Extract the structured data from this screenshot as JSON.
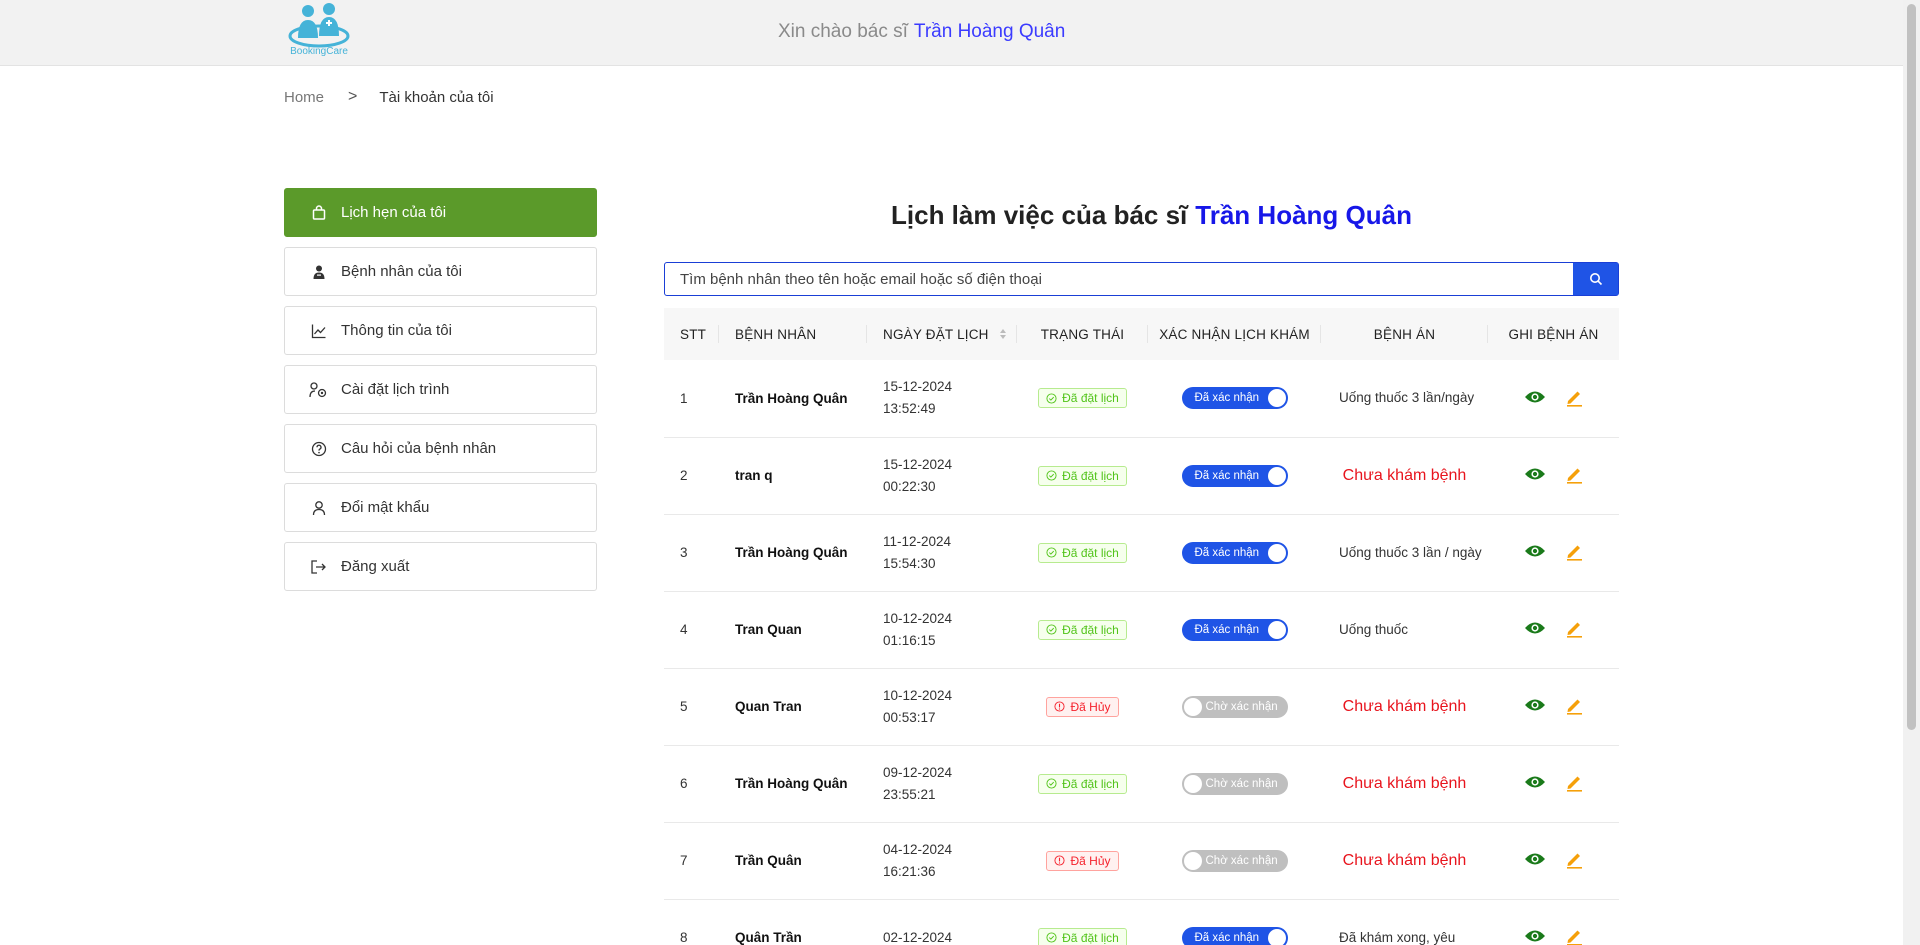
{
  "header": {
    "logo_text": "BookingCare",
    "greeting": "Xin chào bác sĩ",
    "doctor_name": "Trần Hoàng Quân"
  },
  "breadcrumb": {
    "home": "Home",
    "separator": ">",
    "current": "Tài khoản của tôi"
  },
  "sidebar": {
    "items": [
      {
        "label": "Lịch hẹn của tôi",
        "icon": "bag-icon",
        "active": true
      },
      {
        "label": "Bệnh nhân của tôi",
        "icon": "patient-icon"
      },
      {
        "label": "Thông tin của tôi",
        "icon": "chart-icon"
      },
      {
        "label": "Cài đặt lịch trình",
        "icon": "settings-icon"
      },
      {
        "label": "Câu hỏi của bệnh nhân",
        "icon": "question-icon"
      },
      {
        "label": "Đổi mật khẩu",
        "icon": "user-icon"
      },
      {
        "label": "Đăng xuất",
        "icon": "logout-icon"
      }
    ]
  },
  "main": {
    "title": "Lịch làm việc của bác sĩ",
    "title_doctor": "Trần Hoàng Quân",
    "search_placeholder": "Tìm bệnh nhân theo tên hoặc email hoặc số điện thoại"
  },
  "table": {
    "headers": [
      "STT",
      "BỆNH NHÂN",
      "NGÀY ĐẶT LỊCH",
      "TRẠNG THÁI",
      "XÁC NHẬN LỊCH KHÁM",
      "BỆNH ÁN",
      "GHI BỆNH ÁN"
    ],
    "rows": [
      {
        "stt": "1",
        "patient": "Trần Hoàng Quân",
        "date": "15-12-2024",
        "time": "13:52:49",
        "status": "Đã đặt lịch",
        "status_type": "ok",
        "confirm": "Đã xác nhận",
        "confirmed": true,
        "record": "Uống thuốc 3 lần/ngày",
        "record_type": "text"
      },
      {
        "stt": "2",
        "patient": "tran q",
        "date": "15-12-2024",
        "time": "00:22:30",
        "status": "Đã đặt lịch",
        "status_type": "ok",
        "confirm": "Đã xác nhận",
        "confirmed": true,
        "record": "Chưa khám bệnh",
        "record_type": "none"
      },
      {
        "stt": "3",
        "patient": "Trần Hoàng Quân",
        "date": "11-12-2024",
        "time": "15:54:30",
        "status": "Đã đặt lịch",
        "status_type": "ok",
        "confirm": "Đã xác nhận",
        "confirmed": true,
        "record": "Uống thuốc 3 lần / ngày",
        "record_type": "text"
      },
      {
        "stt": "4",
        "patient": "Tran Quan",
        "date": "10-12-2024",
        "time": "01:16:15",
        "status": "Đã đặt lịch",
        "status_type": "ok",
        "confirm": "Đã xác nhận",
        "confirmed": true,
        "record": "Uống thuốc",
        "record_type": "text"
      },
      {
        "stt": "5",
        "patient": "Quan Tran",
        "date": "10-12-2024",
        "time": "00:53:17",
        "status": "Đã Hủy",
        "status_type": "cancel",
        "confirm": "Chờ xác nhận",
        "confirmed": false,
        "record": "Chưa khám bệnh",
        "record_type": "none"
      },
      {
        "stt": "6",
        "patient": "Trần Hoàng Quân",
        "date": "09-12-2024",
        "time": "23:55:21",
        "status": "Đã đặt lịch",
        "status_type": "ok",
        "confirm": "Chờ xác nhận",
        "confirmed": false,
        "record": "Chưa khám bệnh",
        "record_type": "none"
      },
      {
        "stt": "7",
        "patient": "Trần Quân",
        "date": "04-12-2024",
        "time": "16:21:36",
        "status": "Đã Hủy",
        "status_type": "cancel",
        "confirm": "Chờ xác nhận",
        "confirmed": false,
        "record": "Chưa khám bệnh",
        "record_type": "none"
      },
      {
        "stt": "8",
        "patient": "Quân Trần",
        "date": "02-12-2024",
        "time": "",
        "status": "Đã đặt lịch",
        "status_type": "ok",
        "confirm": "Đã xác nhận",
        "confirmed": true,
        "record": "Đã khám xong, yêu",
        "record_type": "text"
      }
    ]
  },
  "colors": {
    "accent_green": "#5b9a2a",
    "primary_blue": "#1f54e6",
    "doctor_name": "#1717e8",
    "danger_red": "#e8141d",
    "view_icon": "#1a7a1a",
    "edit_icon": "#f5a00a"
  }
}
